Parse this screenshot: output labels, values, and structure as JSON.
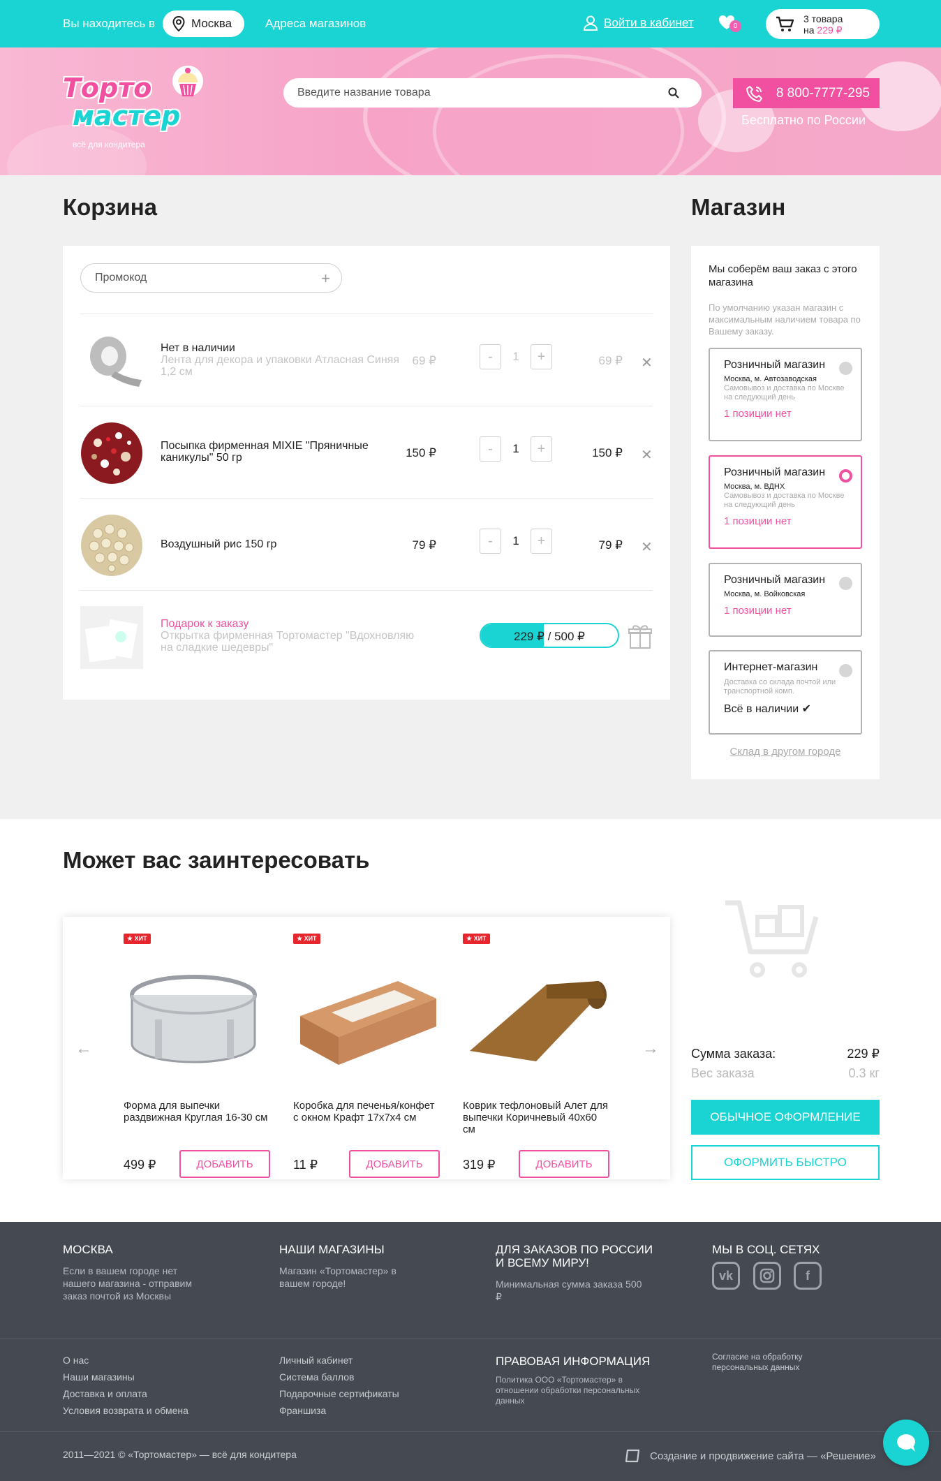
{
  "header": {
    "location_label": "Вы находитесь в",
    "city": "Москва",
    "stores_link": "Адреса магазинов",
    "login": "Войти в кабинет",
    "wishlist_count": "0",
    "cart_count": "3 товара",
    "cart_on": "на",
    "cart_total": "229 ₽"
  },
  "banner": {
    "logo_line1": "Торто",
    "logo_line2": "мастер",
    "logo_tagline": "всё для кондитера",
    "search_placeholder": "Введите название товара",
    "phone": "8 800-7777-295",
    "phone_note": "Бесплатно по России"
  },
  "cart": {
    "title": "Корзина",
    "promo_placeholder": "Промокод",
    "items": [
      {
        "status": "Нет в наличии",
        "name": "Лента для декора и упаковки Атласная Синяя 1,2 см",
        "price": "69 ₽",
        "qty": "1",
        "sum": "69 ₽",
        "available": false
      },
      {
        "status": "",
        "name": "Посыпка фирменная MIXIE \"Пряничные каникулы\" 50 гр",
        "price": "150 ₽",
        "qty": "1",
        "sum": "150 ₽",
        "available": true
      },
      {
        "status": "",
        "name": "Воздушный рис 150 гр",
        "price": "79 ₽",
        "qty": "1",
        "sum": "79 ₽",
        "available": true
      }
    ],
    "gift": {
      "label": "Подарок к заказу",
      "name": "Открытка фирменная Тортомастер \"Вдохновляю на сладкие шедевры\"",
      "progress_current": "229 ₽",
      "progress_sep": "/",
      "progress_target": "500 ₽",
      "progress_fraction": 0.458
    }
  },
  "store": {
    "title": "Магазин",
    "heading": "Мы соберём ваш заказ с этого магазина",
    "note": "По умолчанию указан магазин с максимальным наличием товара по Вашему заказу.",
    "options": [
      {
        "type": "Розничный магазин",
        "address": "Москва, м. Автозаводская",
        "delivery": "Самовывоз и доставка по Москве на следующий день",
        "availability": "1 позиции нет",
        "selected": false
      },
      {
        "type": "Розничный магазин",
        "address": "Москва, м. ВДНХ",
        "delivery": "Самовывоз и доставка по Москве на следующий день",
        "availability": "1 позиции нет",
        "selected": true
      },
      {
        "type": "Розничный магазин",
        "address": "Москва, м. Войковская",
        "delivery": "",
        "availability": "1 позиции нет",
        "selected": false
      },
      {
        "type": "Интернет-магазин",
        "address": "",
        "delivery": "Доставка со склада почтой или транспортной комп.",
        "availability": "Всё в наличии ✔",
        "selected": false
      }
    ],
    "other_city": "Склад в другом городе"
  },
  "recommend": {
    "title": "Может вас заинтересовать",
    "products": [
      {
        "badge": "ХИТ",
        "name": "Форма для выпечки раздвижная Круглая 16-30 см",
        "price": "499 ₽",
        "button": "ДОБАВИТЬ"
      },
      {
        "badge": "ХИТ",
        "name": "Коробка для печенья/конфет с окном Крафт 17х7х4 см",
        "price": "11 ₽",
        "button": "ДОБАВИТЬ"
      },
      {
        "badge": "ХИТ",
        "name": "Коврик тефлоновый Алет для выпечки Коричневый 40х60 см",
        "price": "319 ₽",
        "button": "ДОБАВИТЬ"
      }
    ]
  },
  "summary": {
    "total_label": "Сумма заказа:",
    "total_value": "229 ₽",
    "weight_label": "Вес заказа",
    "weight_value": "0.3 кг",
    "checkout": "ОБЫЧНОЕ ОФОРМЛЕНИЕ",
    "quick": "ОФОРМИТЬ БЫСТРО"
  },
  "footer": {
    "col1_title": "МОСКВА",
    "col1_text": "Если в вашем городе нет нашего магазина - отправим заказ почтой из Москвы",
    "col2_title": "НАШИ МАГАЗИНЫ",
    "col2_text": "Магазин «Тортомастер» в вашем городе!",
    "col3_title": "ДЛЯ ЗАКАЗОВ ПО РОССИИ И ВСЕМУ МИРУ!",
    "col3_text": "Минимальная сумма заказа 500 ₽",
    "col4_title": "МЫ В СОЦ. СЕТЯХ",
    "social": [
      "vk-icon",
      "instagram-icon",
      "facebook-icon"
    ],
    "links1": [
      "О нас",
      "Наши магазины",
      "Доставка и оплата",
      "Условия возврата и обмена"
    ],
    "links2": [
      "Личный кабинет",
      "Система баллов",
      "Подарочные сертификаты",
      "Франшиза"
    ],
    "legal_title": "ПРАВОВАЯ ИНФОРМАЦИЯ",
    "legal_text": "Политика ООО «Тортомастер» в отношении обработки персональных данных",
    "consent": "Согласие на обработку персональных данных",
    "copyright": "2011—2021 © «Тортомастер» — всё для кондитера",
    "made_by": "Создание и продвижение сайта — «Решение»"
  },
  "colors": {
    "accent": "#1ad3d3",
    "brand": "#f0509f",
    "footer": "#454a52"
  }
}
